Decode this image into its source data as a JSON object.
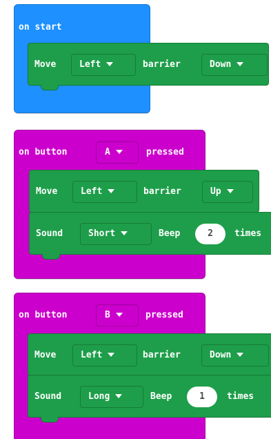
{
  "blocks": {
    "on_start": {
      "label": "on start",
      "move": {
        "move_label": "Move",
        "direction": "Left",
        "barrier_label": "barrier",
        "barrier_value": "Down"
      }
    },
    "on_button_a": {
      "on_button_label": "on button",
      "button_value": "A",
      "pressed_label": "pressed",
      "move": {
        "move_label": "Move",
        "direction": "Left",
        "barrier_label": "barrier",
        "barrier_value": "Up"
      },
      "sound": {
        "sound_label": "Sound",
        "length": "Short",
        "beep_label": "Beep",
        "count": "2",
        "times_label": "times"
      }
    },
    "on_button_b": {
      "on_button_label": "on button",
      "button_value": "B",
      "pressed_label": "pressed",
      "move": {
        "move_label": "Move",
        "direction": "Left",
        "barrier_label": "barrier",
        "barrier_value": "Down"
      },
      "sound": {
        "sound_label": "Sound",
        "length": "Long",
        "beep_label": "Beep",
        "count": "1",
        "times_label": "times"
      }
    }
  },
  "colors": {
    "event_blue": "#1e90ff",
    "event_magenta": "#cc00cc",
    "statement_green": "#1e9e4a",
    "number_field": "#ffffff"
  },
  "icons": {
    "dropdown": "caret-down-icon"
  }
}
